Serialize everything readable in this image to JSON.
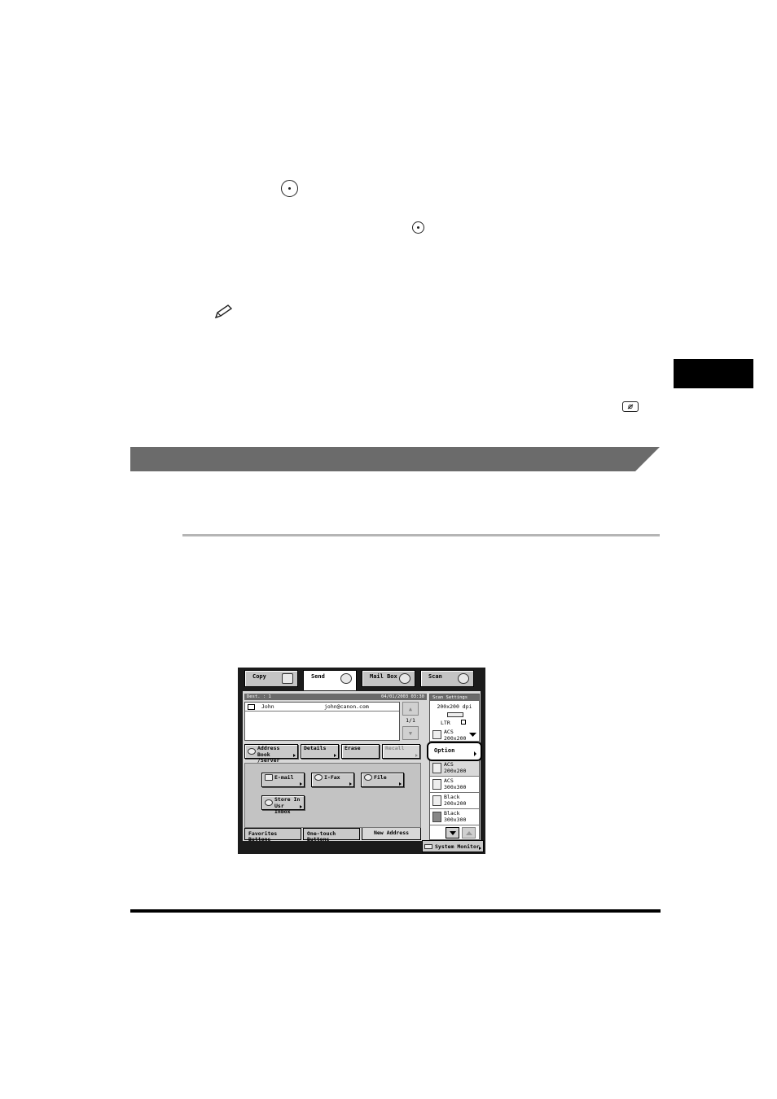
{
  "screen": {
    "tabs": [
      {
        "label": "Copy"
      },
      {
        "label": "Send"
      },
      {
        "label": "Mail Box"
      },
      {
        "label": "Scan"
      }
    ],
    "dest_header_left": "Dest. :  1",
    "dest_header_right": "04/01/2003 03:30",
    "destination": {
      "name": "John",
      "address": "john@canon.com"
    },
    "page_indicator": "1/1",
    "action_buttons": {
      "address_book_line1": "Address Book",
      "address_book_line2": "/Server",
      "details": "Details",
      "erase": "Erase",
      "recall": "Recall"
    },
    "type_buttons": {
      "email": "E-mail",
      "ifax": "I-Fax",
      "file": "File",
      "store_line1": "Store In",
      "store_line2": "Usr Inbox"
    },
    "bottom_tabs": {
      "favorites": "Favorites Buttons",
      "one_touch": "One-touch Buttons",
      "new_address": "New Address"
    },
    "scan_settings": {
      "header": "Scan Settings",
      "resolution": "200x200 dpi",
      "paper": "LTR",
      "current_mode": {
        "line1": "ACS",
        "line2": "200x200"
      },
      "option_label": "Option",
      "modes": [
        {
          "line1": "ACS",
          "line2": "200x200"
        },
        {
          "line1": "ACS",
          "line2": "300x300"
        },
        {
          "line1": "Black",
          "line2": "200x200"
        },
        {
          "line1": "Black",
          "line2": "300x300"
        }
      ]
    },
    "system_monitor": "System Monitor"
  }
}
